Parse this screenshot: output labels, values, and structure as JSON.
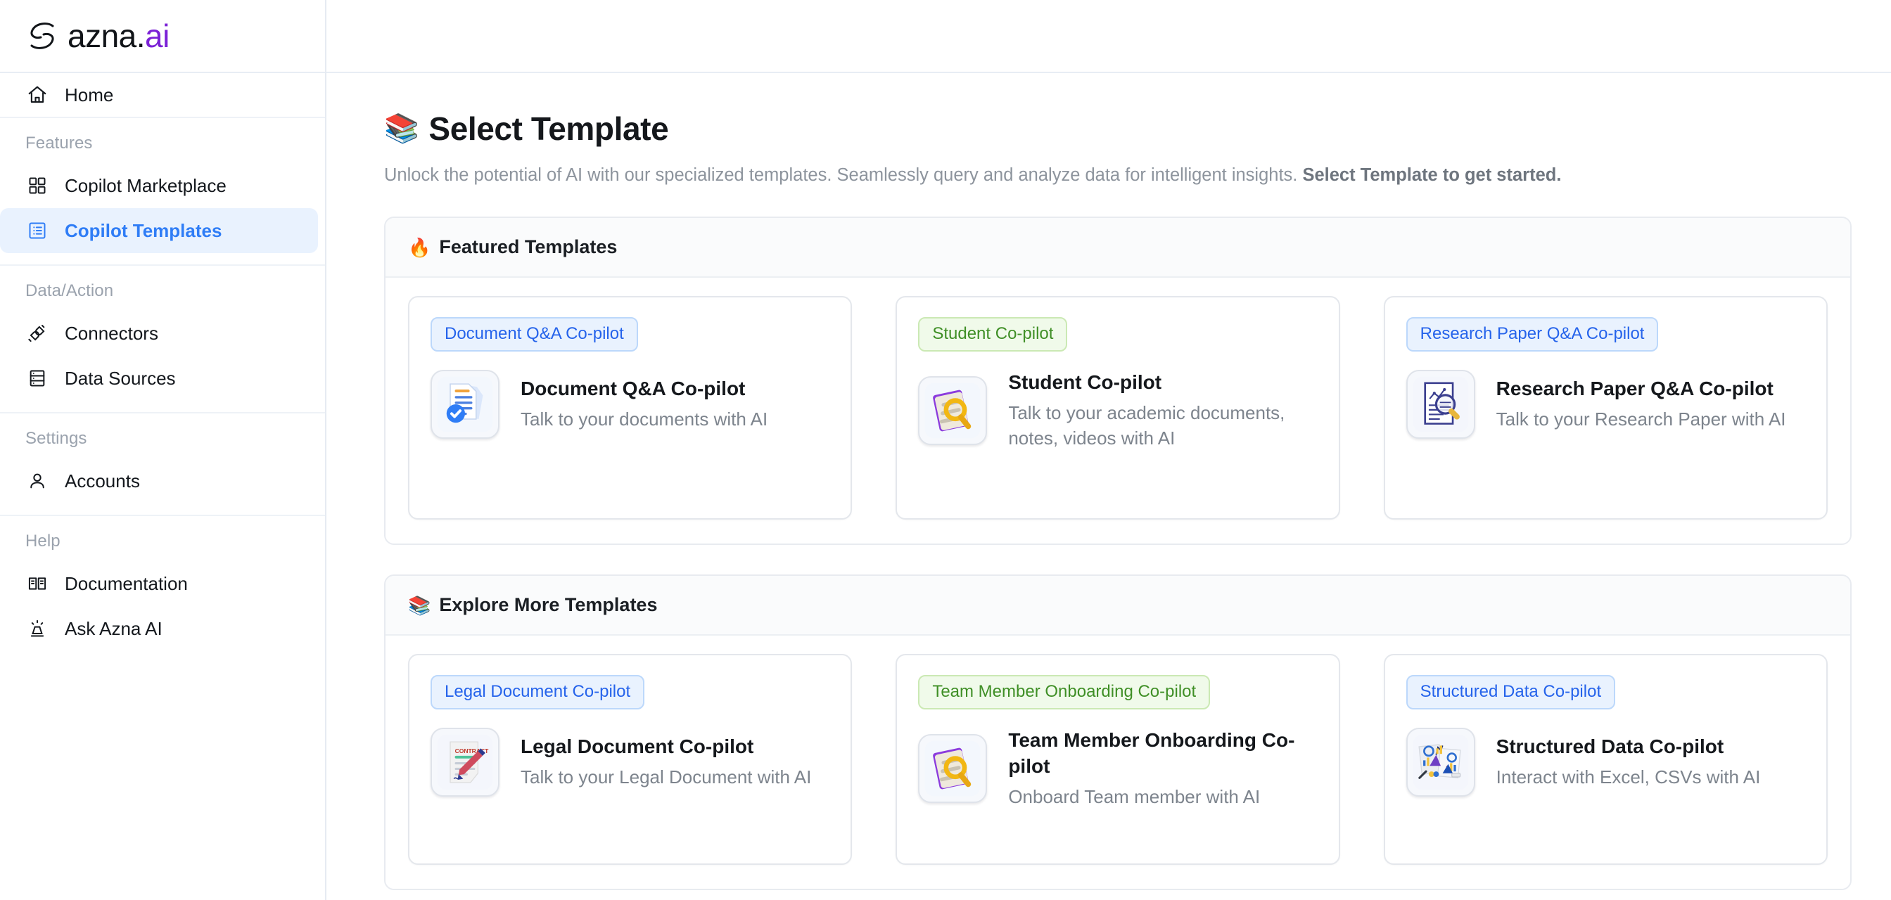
{
  "brand": {
    "name_main": "azna",
    "name_dot": ".",
    "name_suffix": "ai",
    "accent": "#7b21d6"
  },
  "sidebar": {
    "home": {
      "label": "Home",
      "icon": "home-icon"
    },
    "groups": [
      {
        "label": "Features",
        "items": [
          {
            "label": "Copilot Marketplace",
            "icon": "grid-icon",
            "active": false
          },
          {
            "label": "Copilot Templates",
            "icon": "list-box-icon",
            "active": true
          }
        ]
      },
      {
        "label": "Data/Action",
        "items": [
          {
            "label": "Connectors",
            "icon": "plug-icon",
            "active": false
          },
          {
            "label": "Data Sources",
            "icon": "database-icon",
            "active": false
          }
        ]
      },
      {
        "label": "Settings",
        "items": [
          {
            "label": "Accounts",
            "icon": "user-icon",
            "active": false
          }
        ]
      },
      {
        "label": "Help",
        "items": [
          {
            "label": "Documentation",
            "icon": "book-open-icon",
            "active": false
          },
          {
            "label": "Ask Azna AI",
            "icon": "lamp-icon",
            "active": false
          }
        ]
      }
    ],
    "active_bg": "#e9f2fe",
    "active_fg": "#2f7df6"
  },
  "page": {
    "title_emoji": "📚",
    "title": "Select Template",
    "subtitle_plain": "Unlock the potential of AI with our specialized templates. Seamlessly query and analyze data for intelligent insights. ",
    "subtitle_bold": "Select Template to get started."
  },
  "sections": [
    {
      "emoji": "🔥",
      "title": "Featured Templates",
      "cards": [
        {
          "badge": "Document Q&A Co-pilot",
          "badge_color": "blue",
          "title": "Document Q&A Co-pilot",
          "desc": "Talk to your documents with AI",
          "icon": "document-check-icon"
        },
        {
          "badge": "Student Co-pilot",
          "badge_color": "green",
          "title": "Student Co-pilot",
          "desc": "Talk to your academic documents, notes, videos with AI",
          "icon": "notes-magnifier-icon"
        },
        {
          "badge": "Research Paper Q&A Co-pilot",
          "badge_color": "blue",
          "title": "Research Paper Q&A Co-pilot",
          "desc": "Talk to your Research Paper with AI",
          "icon": "research-paper-icon"
        }
      ]
    },
    {
      "emoji": "📚",
      "title": "Explore More Templates",
      "cards": [
        {
          "badge": "Legal Document Co-pilot",
          "badge_color": "blue",
          "title": "Legal Document Co-pilot",
          "desc": "Talk to your Legal Document with AI",
          "icon": "contract-pen-icon"
        },
        {
          "badge": "Team Member Onboarding Co-pilot",
          "badge_color": "green",
          "title": "Team Member Onboarding Co-pilot",
          "desc": "Onboard Team member with AI",
          "icon": "notes-magnifier-icon"
        },
        {
          "badge": "Structured Data Co-pilot",
          "badge_color": "blue",
          "title": "Structured Data Co-pilot",
          "desc": "Interact with Excel, CSVs with AI",
          "icon": "charts-report-icon"
        }
      ]
    }
  ]
}
